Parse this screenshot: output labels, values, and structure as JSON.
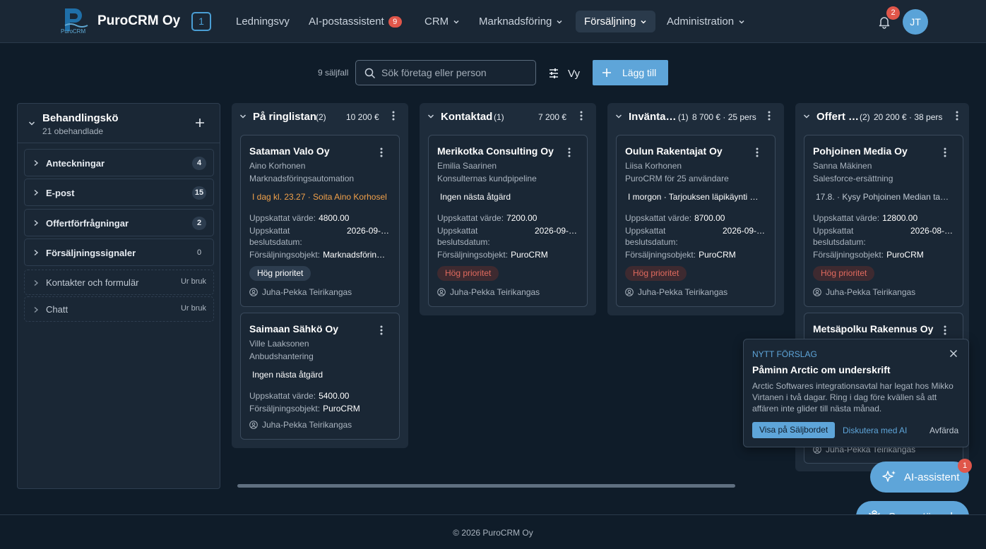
{
  "app": {
    "brand": "PuroCRM Oy",
    "logo_sub": "PuroCRM",
    "workspace_badge": "1",
    "accent_color": "#5ea5d9",
    "danger_color": "#e0564a"
  },
  "nav": {
    "items": [
      {
        "label": "Ledningsvy"
      },
      {
        "label": "AI-postassistent",
        "badge": "9"
      },
      {
        "label": "CRM"
      },
      {
        "label": "Marknadsföring"
      },
      {
        "label": "Försäljning"
      },
      {
        "label": "Administration"
      }
    ],
    "notifications": "2",
    "avatar": "JT"
  },
  "toolbar": {
    "count": "9 säljfall",
    "search_placeholder": "Sök företag eller person",
    "view_label": "Vy",
    "add_label": "Lägg till"
  },
  "queue": {
    "title": "Behandlingskö",
    "subtitle": "21 obehandlade",
    "items": [
      {
        "label": "Anteckningar",
        "count": "4"
      },
      {
        "label": "E-post",
        "count": "15"
      },
      {
        "label": "Offertförfrågningar",
        "count": "2"
      },
      {
        "label": "Försäljningssignaler",
        "count": "0"
      },
      {
        "label": "Kontakter och formulär",
        "status": "Ur bruk"
      },
      {
        "label": "Chatt",
        "status": "Ur bruk"
      }
    ]
  },
  "columns": [
    {
      "title": "På ringlistan",
      "count": "(2)",
      "sum": "10 200 €",
      "cards": [
        {
          "company": "Sataman Valo Oy",
          "person": "Aino Korhonen",
          "product": "Marknadsföringsautomation",
          "next_action": "I dag kl. 23.27 · Soita Aino Korhosel",
          "value_label": "Uppskattat värde:",
          "value": "4800.00",
          "date_label_1": "Uppskattat",
          "date_label_2": "beslutsdatum:",
          "date": "2026-09-…",
          "object_label": "Försäljningsobjekt:",
          "object": "Marknadsförin…",
          "priority": "Hög prioritet",
          "owner": "Juha-Pekka Teirikangas"
        },
        {
          "company": "Saimaan Sähkö Oy",
          "person": "Ville Laaksonen",
          "product": "Anbudshantering",
          "next_action": "Ingen nästa åtgärd",
          "value_label": "Uppskattat värde:",
          "value": "5400.00",
          "object_label": "Försäljningsobjekt:",
          "object": "PuroCRM",
          "owner": "Juha-Pekka Teirikangas"
        }
      ]
    },
    {
      "title": "Kontaktad",
      "count": "(1)",
      "sum": "7 200 €",
      "cards": [
        {
          "company": "Merikotka Consulting Oy",
          "person": "Emilia Saarinen",
          "product": "Konsulternas kundpipeline",
          "next_action": "Ingen nästa åtgärd",
          "value_label": "Uppskattat värde:",
          "value": "7200.00",
          "date_label_1": "Uppskattat",
          "date_label_2": "beslutsdatum:",
          "date": "2026-09-…",
          "object_label": "Försäljningsobjekt:",
          "object": "PuroCRM",
          "priority": "Hög prioritet",
          "owner": "Juha-Pekka Teirikangas"
        }
      ]
    },
    {
      "title": "Inväntа…",
      "count": "(1)",
      "sum": "8 700 € · 25 pers",
      "cards": [
        {
          "company": "Oulun Rakentajat Oy",
          "person": "Liisa Korhonen",
          "product": "PuroCRM för 25 användare",
          "next_action": "I morgon · Tarjouksen läpikäynti …",
          "value_label": "Uppskattat värde:",
          "value": "8700.00",
          "date_label_1": "Uppskattat",
          "date_label_2": "beslutsdatum:",
          "date": "2026-09-…",
          "object_label": "Försäljningsobjekt:",
          "object": "PuroCRM",
          "priority": "Hög prioritet",
          "owner": "Juha-Pekka Teirikangas"
        }
      ]
    },
    {
      "title": "Offert …",
      "count": "(2)",
      "sum": "20 200 € · 38 pers",
      "cards": [
        {
          "company": "Pohjoinen Media Oy",
          "person": "Sanna Mäkinen",
          "product": "Salesforce-ersättning",
          "next_action": "17.8. · Kysy Pohjoinen Median tarj…",
          "value_label": "Uppskattat värde:",
          "value": "12800.00",
          "date_label_1": "Uppskattat",
          "date_label_2": "beslutsdatum:",
          "date": "2026-08-…",
          "object_label": "Försäljningsobjekt:",
          "object": "PuroCRM",
          "priority": "Hög prioritet",
          "owner": "Juha-Pekka Teirikangas"
        },
        {
          "company": "Metsäpolku Rakennus Oy",
          "owner": "Juha-Pekka Teirikangas"
        }
      ]
    }
  ],
  "suggestion": {
    "kicker": "NYTT FÖRSLAG",
    "title": "Påminn Arctic om underskrift",
    "body": "Arctic Softwares integrationsavtal har legat hos Mikko Virtanen i två dagar. Ring i dag före kvällen så att affären inte glider till nästa månad.",
    "primary": "Visa på Säljbordet",
    "secondary": "Diskutera med AI",
    "dismiss": "Avfärda"
  },
  "fab": {
    "ai_label": "AI-assistent",
    "ai_badge": "1",
    "support_label": "Supportärende"
  },
  "footer": "© 2026 PuroCRM Oy"
}
